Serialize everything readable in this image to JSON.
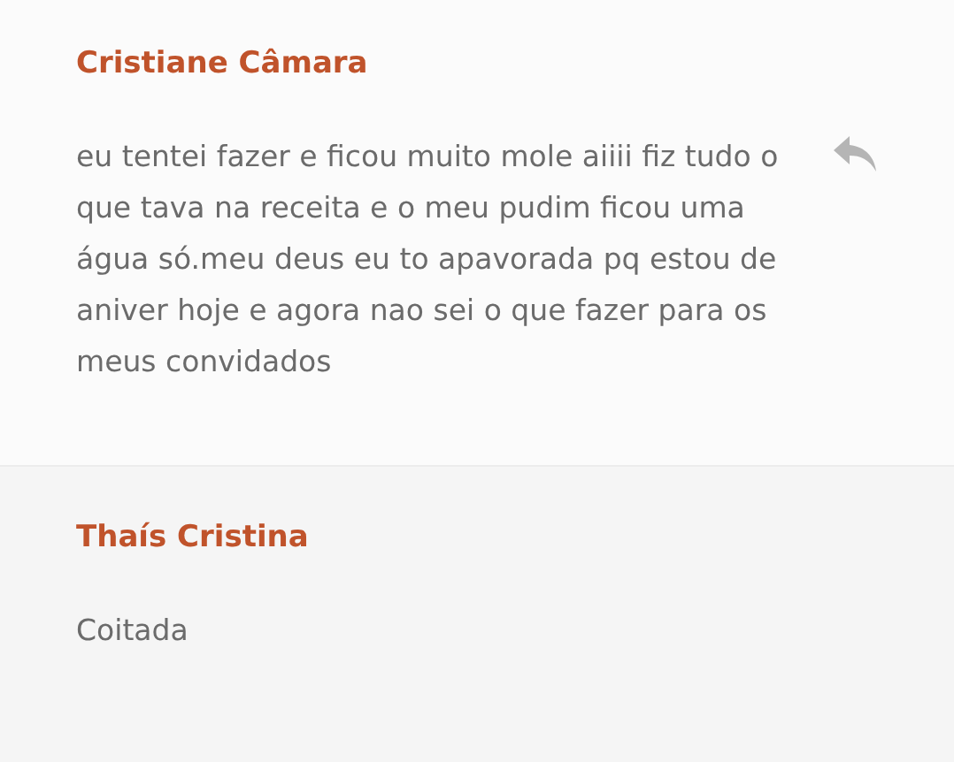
{
  "comments": [
    {
      "author": "Cristiane Câmara",
      "text": "eu tentei fazer e ficou muito mole aiiii fiz tudo o que tava na receita e o meu pudim ficou uma água só.meu deus eu to apavorada pq estou de aniver hoje e agora nao sei o que fazer para os meus convidados",
      "reply_icon": true
    },
    {
      "author": "Thaís Cristina",
      "text": "Coitada",
      "reply_icon": false
    }
  ]
}
